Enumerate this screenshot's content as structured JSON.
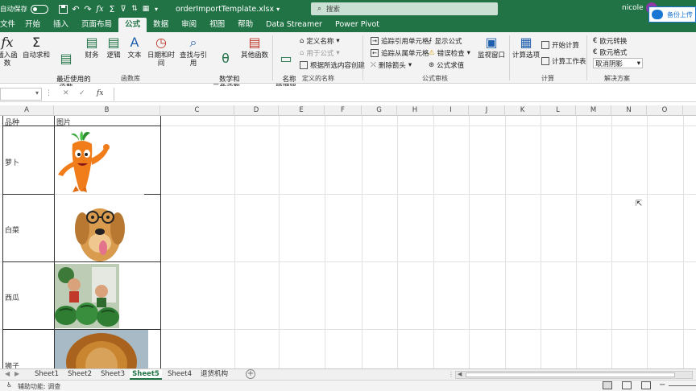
{
  "title": {
    "autosave": "自动保存",
    "filename": "orderImportTemplate.xlsx",
    "search_placeholder": "搜索",
    "user": "nicole",
    "cloud": "备份上传"
  },
  "tabs": [
    "文件",
    "开始",
    "插入",
    "页面布局",
    "公式",
    "数据",
    "审阅",
    "视图",
    "帮助",
    "Data Streamer",
    "Power Pivot"
  ],
  "ribbon": {
    "fx_insert": "插入函数",
    "autosum": "自动求和",
    "recent": "最近使用的\n函数",
    "finance": "财务",
    "logic": "逻辑",
    "text": "文本",
    "datetime": "日期和时间",
    "lookup": "查找与引用",
    "math": "数学和\n三角函数",
    "other": "其他函数",
    "group_lib": "函数库",
    "name_mgr": "名称\n管理器",
    "define_name": "定义名称",
    "use_formula": "用于公式",
    "create_sel": "根据所选内容创建",
    "group_names": "定义的名称",
    "trace_prec": "追踪引用单元格",
    "trace_dep": "追踪从属单元格",
    "remove_arrows": "删除箭头",
    "show_formulas": "显示公式",
    "error_check": "错误检查",
    "eval_formula": "公式求值",
    "group_audit": "公式审核",
    "watch": "监视窗口",
    "calc_options": "计算选项",
    "calc_now": "开始计算",
    "calc_sheet": "计算工作表",
    "group_calc": "计算",
    "convert1": "欧元转换",
    "convert2": "欧元格式",
    "dropdown": "取消阴影",
    "group_solution": "解决方案"
  },
  "formula": {
    "fx": "fx"
  },
  "columns": [
    "A",
    "B",
    "C",
    "D",
    "E",
    "F",
    "G",
    "H",
    "I",
    "J",
    "K",
    "L",
    "M",
    "N",
    "O"
  ],
  "cells": {
    "a1": "品种",
    "b1": "图片",
    "rows": [
      "萝卜",
      "白菜",
      "西瓜",
      "狮子"
    ]
  },
  "sheets": [
    "Sheet1",
    "Sheet2",
    "Sheet3",
    "Sheet5",
    "Sheet4",
    "退货机构"
  ],
  "active_sheet": "Sheet5",
  "status": {
    "accessibility": "辅助功能: 调查"
  },
  "colors": {
    "excel_green": "#217346"
  }
}
